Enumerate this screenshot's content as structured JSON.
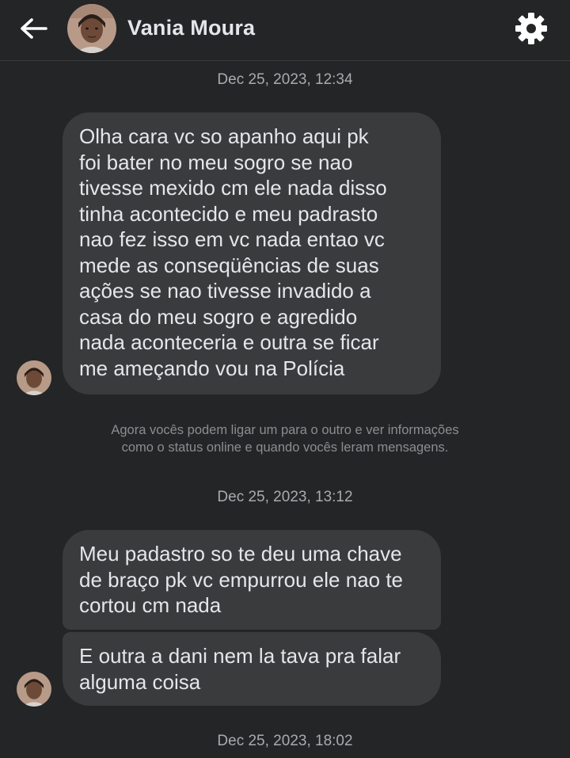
{
  "header": {
    "contact_name": "Vania Moura",
    "back_icon": "arrow-left-icon",
    "settings_icon": "gear-icon"
  },
  "timestamps": {
    "t1": "Dec 25, 2023, 12:34",
    "t2": "Dec 25, 2023, 13:12",
    "t3": "Dec 25, 2023, 18:02"
  },
  "messages": [
    {
      "text": "Olha cara vc so apanho aqui pk\nfoi bater no meu sogro se nao\ntivesse mexido cm ele nada disso\ntinha acontecido e meu padrasto\nnao fez isso em vc nada entao vc\nmede as conseqüências de suas\nações se nao tivesse invadido a\ncasa do meu sogro e agredido\nnada aconteceria  e outra se ficar\nme ameçando vou na Polícia"
    },
    {
      "text": "Meu padastro so te deu uma chave\nde braço pk vc empurrou ele nao te\ncortou cm nada"
    },
    {
      "text": "E outra a dani nem la tava pra falar\nalguma coisa"
    }
  ],
  "notice": {
    "line1": "Agora vocês podem ligar um para o outro e ver informações",
    "line2": "como o status online e quando vocês leram mensagens."
  },
  "colors": {
    "background": "#242526",
    "bubble": "#3a3b3c",
    "text": "#e4e6eb",
    "muted": "#a8abaf"
  }
}
